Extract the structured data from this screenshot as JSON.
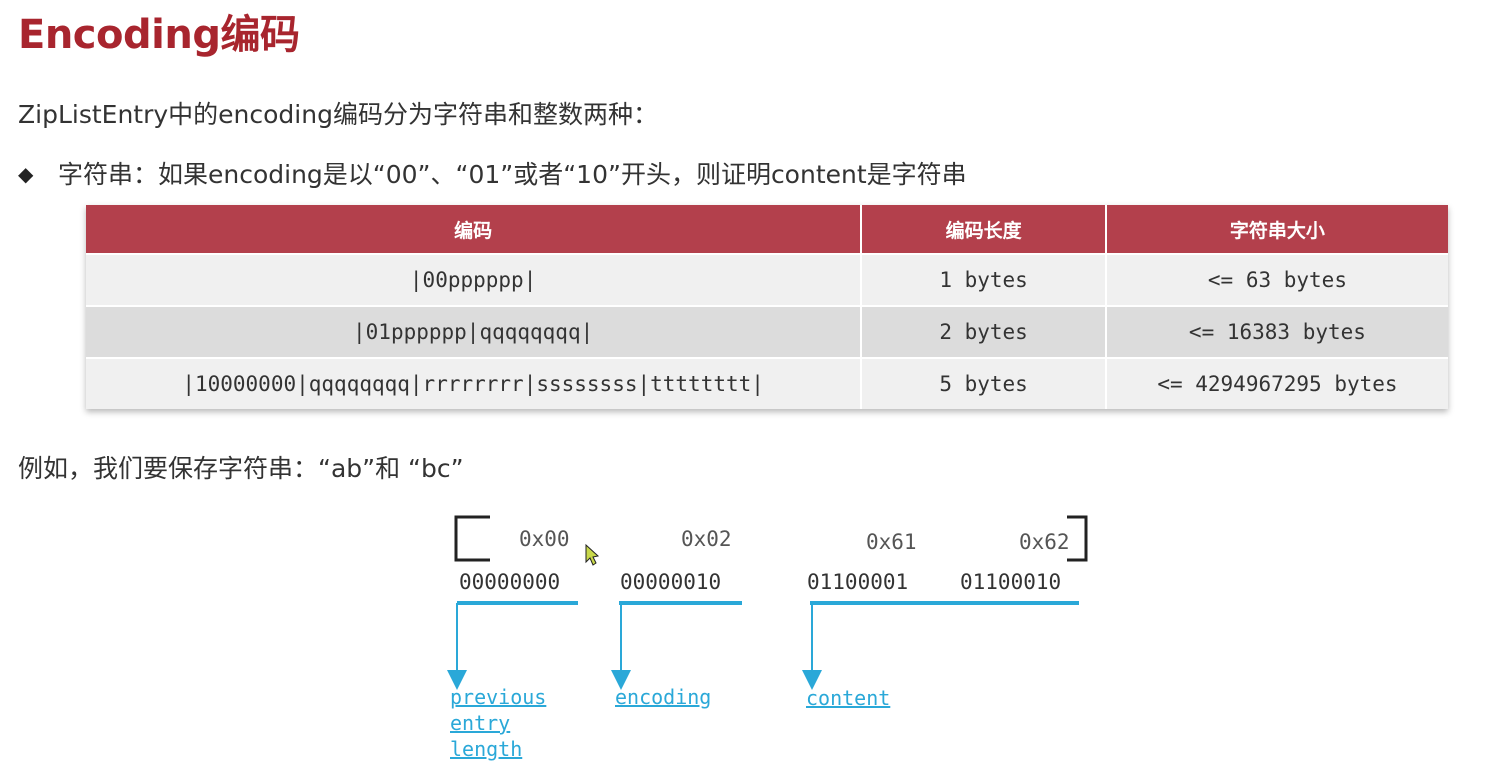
{
  "title": "Encoding编码",
  "intro": "ZipListEntry中的encoding编码分为字符串和整数两种：",
  "bullet": {
    "glyph": "◆",
    "text": "字符串：如果encoding是以“00”、“01”或者“10”开头，则证明content是字符串"
  },
  "table": {
    "headers": [
      "编码",
      "编码长度",
      "字符串大小"
    ],
    "rows": [
      [
        "|00pppppp|",
        "1 bytes",
        "<= 63 bytes"
      ],
      [
        "|01pppppp|qqqqqqqq|",
        "2 bytes",
        "<= 16383 bytes"
      ],
      [
        "|10000000|qqqqqqqq|rrrrrrrr|ssssssss|tttttttt|",
        "5 bytes",
        "<= 4294967295 bytes"
      ]
    ]
  },
  "example": "例如，我们要保存字符串：“ab”和 “bc”",
  "diagram": {
    "hex": [
      "0x00",
      "0x02",
      "0x61",
      "0x62"
    ],
    "bin": [
      "00000000",
      "00000010",
      "01100001",
      "01100010"
    ],
    "labels": {
      "previous_entry_length": [
        "previous",
        "entry",
        "length"
      ],
      "encoding": "encoding",
      "content": "content"
    },
    "colors": {
      "accent": "#2aa8d8",
      "title": "#a8252e",
      "table_header": "#b3404c"
    }
  }
}
